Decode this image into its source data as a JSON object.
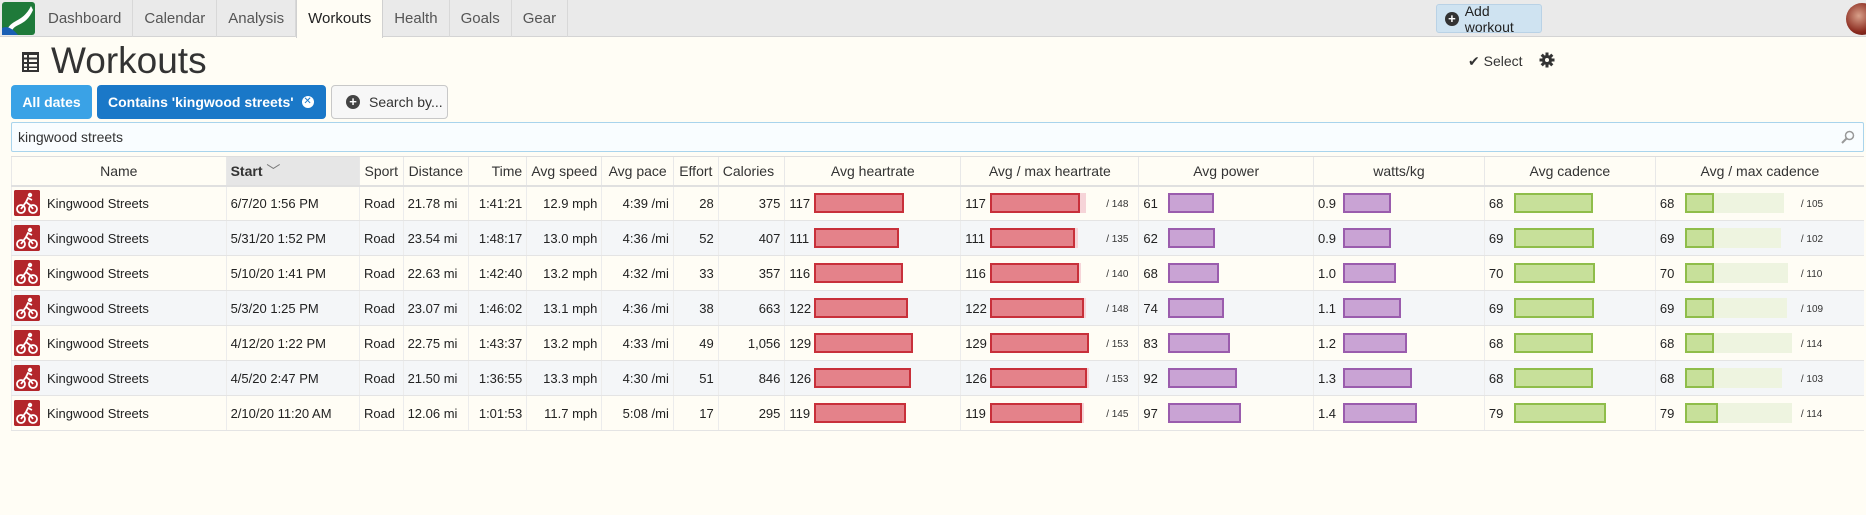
{
  "nav": {
    "tabs": [
      "Dashboard",
      "Calendar",
      "Analysis",
      "Workouts",
      "Health",
      "Goals",
      "Gear"
    ],
    "active_index": 3,
    "add_workout_label": "Add workout"
  },
  "page": {
    "title": "Workouts",
    "select_label": "Select"
  },
  "filters": {
    "all_dates_label": "All dates",
    "contains_label": "Contains 'kingwood streets'",
    "search_by_label": "Search by..."
  },
  "search": {
    "value": "kingwood streets"
  },
  "table": {
    "headers": {
      "name": "Name",
      "start": "Start",
      "sport": "Sport",
      "distance": "Distance",
      "time": "Time",
      "avg_speed": "Avg speed",
      "avg_pace": "Avg pace",
      "effort": "Effort",
      "calories": "Calories",
      "avg_heartrate": "Avg heartrate",
      "avg_max_heartrate": "Avg / max heartrate",
      "avg_power": "Avg power",
      "watts_kg": "watts/kg",
      "avg_cadence": "Avg cadence",
      "avg_max_cadence": "Avg / max cadence"
    },
    "rows": [
      {
        "name": "Kingwood Streets",
        "start": "6/7/20 1:56 PM",
        "sport": "Road",
        "distance": "21.78 mi",
        "time": "1:41:21",
        "avg_speed": "12.9 mph",
        "avg_pace": "4:39 /mi",
        "effort": "28",
        "calories": "375",
        "avg_hr": "117",
        "hr_avg": "117",
        "hr_max": "/ 148",
        "hr_max_num": 148,
        "power": "61",
        "wkg": "0.9",
        "cadence": "68",
        "cad_avg": "68",
        "cad_max": "/ 105",
        "cad_max_num": 105
      },
      {
        "name": "Kingwood Streets",
        "start": "5/31/20 1:52 PM",
        "sport": "Road",
        "distance": "23.54 mi",
        "time": "1:48:17",
        "avg_speed": "13.0 mph",
        "avg_pace": "4:36 /mi",
        "effort": "52",
        "calories": "407",
        "avg_hr": "111",
        "hr_avg": "111",
        "hr_max": "/ 135",
        "hr_max_num": 135,
        "power": "62",
        "wkg": "0.9",
        "cadence": "69",
        "cad_avg": "69",
        "cad_max": "/ 102",
        "cad_max_num": 102
      },
      {
        "name": "Kingwood Streets",
        "start": "5/10/20 1:41 PM",
        "sport": "Road",
        "distance": "22.63 mi",
        "time": "1:42:40",
        "avg_speed": "13.2 mph",
        "avg_pace": "4:32 /mi",
        "effort": "33",
        "calories": "357",
        "avg_hr": "116",
        "hr_avg": "116",
        "hr_max": "/ 140",
        "hr_max_num": 140,
        "power": "68",
        "wkg": "1.0",
        "cadence": "70",
        "cad_avg": "70",
        "cad_max": "/ 110",
        "cad_max_num": 110
      },
      {
        "name": "Kingwood Streets",
        "start": "5/3/20 1:25 PM",
        "sport": "Road",
        "distance": "23.07 mi",
        "time": "1:46:02",
        "avg_speed": "13.1 mph",
        "avg_pace": "4:36 /mi",
        "effort": "38",
        "calories": "663",
        "avg_hr": "122",
        "hr_avg": "122",
        "hr_max": "/ 148",
        "hr_max_num": 148,
        "power": "74",
        "wkg": "1.1",
        "cadence": "69",
        "cad_avg": "69",
        "cad_max": "/ 109",
        "cad_max_num": 109
      },
      {
        "name": "Kingwood Streets",
        "start": "4/12/20 1:22 PM",
        "sport": "Road",
        "distance": "22.75 mi",
        "time": "1:43:37",
        "avg_speed": "13.2 mph",
        "avg_pace": "4:33 /mi",
        "effort": "49",
        "calories": "1,056",
        "avg_hr": "129",
        "hr_avg": "129",
        "hr_max": "/ 153",
        "hr_max_num": 153,
        "power": "83",
        "wkg": "1.2",
        "cadence": "68",
        "cad_avg": "68",
        "cad_max": "/ 114",
        "cad_max_num": 114
      },
      {
        "name": "Kingwood Streets",
        "start": "4/5/20 2:47 PM",
        "sport": "Road",
        "distance": "21.50 mi",
        "time": "1:36:55",
        "avg_speed": "13.3 mph",
        "avg_pace": "4:30 /mi",
        "effort": "51",
        "calories": "846",
        "avg_hr": "126",
        "hr_avg": "126",
        "hr_max": "/ 153",
        "hr_max_num": 153,
        "power": "92",
        "wkg": "1.3",
        "cadence": "68",
        "cad_avg": "68",
        "cad_max": "/ 103",
        "cad_max_num": 103
      },
      {
        "name": "Kingwood Streets",
        "start": "2/10/20 11:20 AM",
        "sport": "Road",
        "distance": "12.06 mi",
        "time": "1:01:53",
        "avg_speed": "11.7 mph",
        "avg_pace": "5:08 /mi",
        "effort": "17",
        "calories": "295",
        "avg_hr": "119",
        "hr_avg": "119",
        "hr_max": "/ 145",
        "hr_max_num": 145,
        "power": "97",
        "wkg": "1.4",
        "cadence": "79",
        "cad_avg": "79",
        "cad_max": "/ 114",
        "cad_max_num": 114
      }
    ]
  },
  "colors": {
    "hr_fill": "#e4828a",
    "hr_border": "#c8303a",
    "hr_bg": "#f6d4d8",
    "power_fill": "#c9a3d4",
    "power_border": "#9a5cad",
    "cad_fill": "#c7e09a",
    "cad_border": "#8fbd4a",
    "cad_bg": "#eef4e0",
    "sport_icon": "#b3262b",
    "accent": "#1a78c8"
  },
  "icons": {
    "logo": "app-logo",
    "title": "table-icon",
    "select": "check-icon",
    "settings": "gear-icon",
    "search": "magnifier-icon",
    "sport": "cycling-icon"
  }
}
